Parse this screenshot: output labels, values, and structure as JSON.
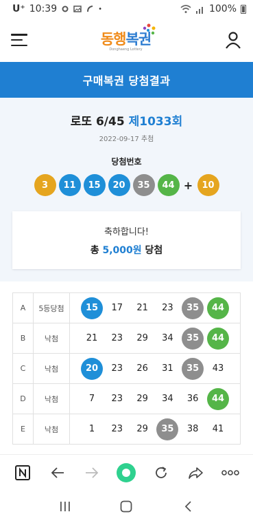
{
  "status_bar": {
    "carrier": "U⁺",
    "time": "10:39",
    "battery": "100%"
  },
  "header": {
    "logo_text_1": "동행",
    "logo_text_2": "복권",
    "logo_sub": "Donghaeng Lottery"
  },
  "page_title": "구매복권 당첨결과",
  "draw": {
    "game_name": "로또 6/45",
    "round": "제1033회",
    "date": "2022-09-17 추첨",
    "winning_label": "당첨번호",
    "numbers": [
      {
        "value": "3",
        "color": "#e5a51f"
      },
      {
        "value": "11",
        "color": "#1f8fd8"
      },
      {
        "value": "15",
        "color": "#1f8fd8"
      },
      {
        "value": "20",
        "color": "#1f8fd8"
      },
      {
        "value": "35",
        "color": "#8e8e8e"
      },
      {
        "value": "44",
        "color": "#55b548"
      }
    ],
    "plus": "+",
    "bonus": {
      "value": "10",
      "color": "#e5a51f"
    }
  },
  "prize": {
    "congrats": "축하합니다!",
    "total_prefix": "총",
    "amount": "5,000원",
    "total_suffix": "당첨"
  },
  "ticket_rows": [
    {
      "slot": "A",
      "rank": "5등당첨",
      "nums": [
        {
          "v": "15",
          "hit": true,
          "color": "#1f8fd8"
        },
        {
          "v": "17",
          "hit": false
        },
        {
          "v": "21",
          "hit": false
        },
        {
          "v": "23",
          "hit": false
        },
        {
          "v": "35",
          "hit": true,
          "color": "#8e8e8e"
        },
        {
          "v": "44",
          "hit": true,
          "color": "#55b548"
        }
      ]
    },
    {
      "slot": "B",
      "rank": "낙첨",
      "nums": [
        {
          "v": "21",
          "hit": false
        },
        {
          "v": "23",
          "hit": false
        },
        {
          "v": "29",
          "hit": false
        },
        {
          "v": "34",
          "hit": false
        },
        {
          "v": "35",
          "hit": true,
          "color": "#8e8e8e"
        },
        {
          "v": "44",
          "hit": true,
          "color": "#55b548"
        }
      ]
    },
    {
      "slot": "C",
      "rank": "낙첨",
      "nums": [
        {
          "v": "20",
          "hit": true,
          "color": "#1f8fd8"
        },
        {
          "v": "23",
          "hit": false
        },
        {
          "v": "26",
          "hit": false
        },
        {
          "v": "31",
          "hit": false
        },
        {
          "v": "35",
          "hit": true,
          "color": "#8e8e8e"
        },
        {
          "v": "43",
          "hit": false
        }
      ]
    },
    {
      "slot": "D",
      "rank": "낙첨",
      "nums": [
        {
          "v": "7",
          "hit": false
        },
        {
          "v": "23",
          "hit": false
        },
        {
          "v": "29",
          "hit": false
        },
        {
          "v": "34",
          "hit": false
        },
        {
          "v": "36",
          "hit": false
        },
        {
          "v": "44",
          "hit": true,
          "color": "#55b548"
        }
      ]
    },
    {
      "slot": "E",
      "rank": "낙첨",
      "nums": [
        {
          "v": "1",
          "hit": false
        },
        {
          "v": "23",
          "hit": false
        },
        {
          "v": "29",
          "hit": false
        },
        {
          "v": "35",
          "hit": true,
          "color": "#8e8e8e"
        },
        {
          "v": "38",
          "hit": false
        },
        {
          "v": "41",
          "hit": false
        }
      ]
    }
  ],
  "browser_toolbar": [
    "naver-icon",
    "back-arrow-icon",
    "forward-arrow-icon",
    "home-circle-icon",
    "refresh-icon",
    "share-icon",
    "more-icon"
  ],
  "system_nav": [
    "recents-icon",
    "home-icon",
    "back-icon"
  ],
  "colors": {
    "primary": "#1f7fd2",
    "result_bg": "#f2f6fb",
    "active_green": "#2fd18f"
  }
}
